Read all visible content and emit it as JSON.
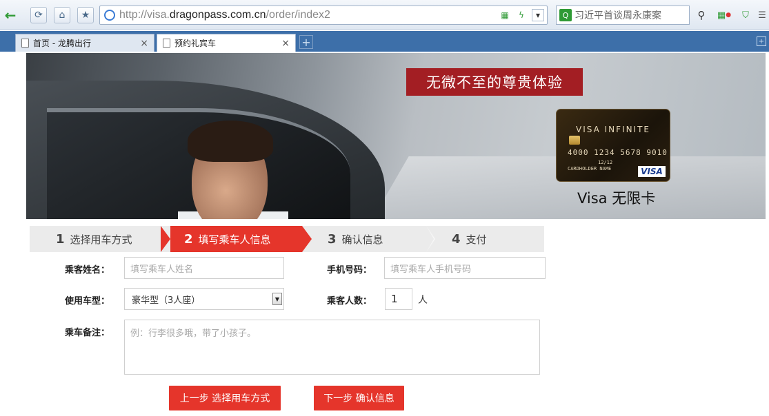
{
  "browser": {
    "url_prefix": "http://visa.",
    "url_domain": "dragonpass.com.cn",
    "url_path": "/order/index2",
    "search_text": "习近平首谈周永康案",
    "tabs": [
      {
        "label": "首页 - 龙腾出行"
      },
      {
        "label": "预约礼宾车"
      }
    ],
    "accent": "#3d6fa9"
  },
  "banner": {
    "slogan": "无微不至的尊贵体验",
    "card_brand": "VISA INFINITE",
    "card_number": "4000 1234 5678 9010",
    "card_expiry": "12/12",
    "card_holder": "CARDHOLDER NAME",
    "card_logo": "VISA",
    "card_caption": "Visa 无限卡"
  },
  "steps": [
    {
      "num": "1",
      "label": "选择用车方式"
    },
    {
      "num": "2",
      "label": "填写乘车人信息"
    },
    {
      "num": "3",
      "label": "确认信息"
    },
    {
      "num": "4",
      "label": "支付"
    }
  ],
  "form": {
    "name_label": "乘客姓名：",
    "name_placeholder": "填写乘车人姓名",
    "phone_label": "手机号码：",
    "phone_placeholder": "填写乘车人手机号码",
    "car_label": "使用车型：",
    "car_value": "豪华型（3人座）",
    "count_label": "乘客人数：",
    "count_value": "1",
    "count_unit": "人",
    "notes_label": "乘车备注：",
    "notes_placeholder": "例：行李很多哦，带了小孩子。"
  },
  "buttons": {
    "prev": "上一步 选择用车方式",
    "next": "下一步 确认信息"
  },
  "colors": {
    "primary_red": "#e5352b",
    "slogan_red": "#a31e23"
  }
}
